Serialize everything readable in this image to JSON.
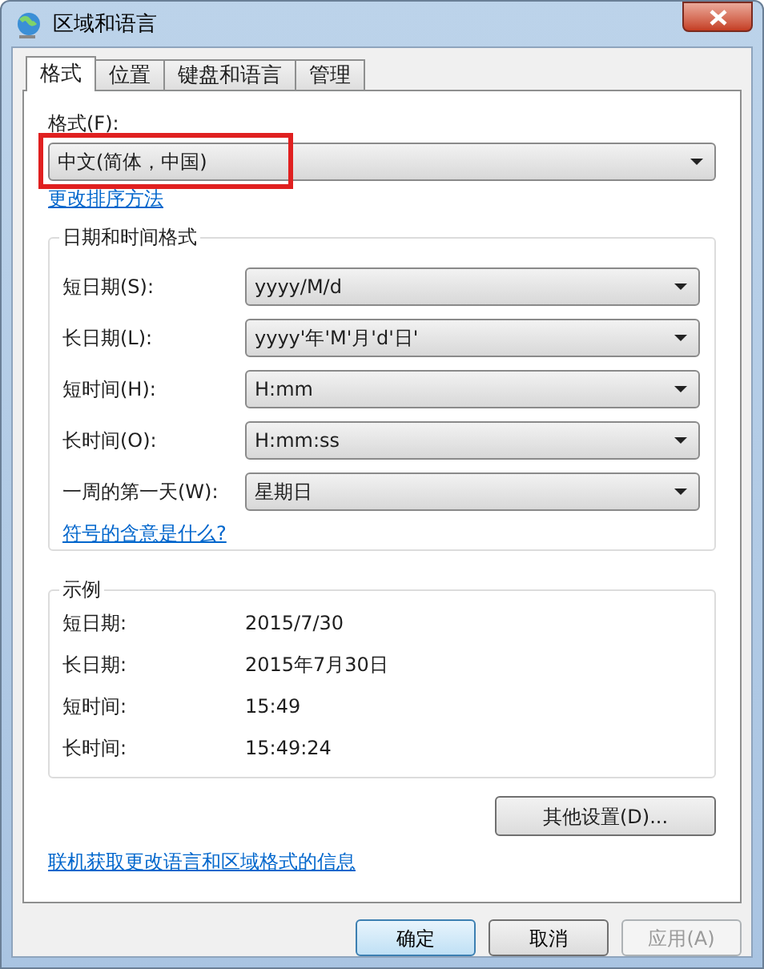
{
  "window": {
    "title": "区域和语言"
  },
  "tabs": [
    {
      "label": "格式",
      "selected": true
    },
    {
      "label": "位置",
      "selected": false
    },
    {
      "label": "键盘和语言",
      "selected": false
    },
    {
      "label": "管理",
      "selected": false
    }
  ],
  "format": {
    "label": "格式(F):",
    "value": "中文(简体，中国)",
    "highlighted": true
  },
  "sort_link": "更改排序方法",
  "datetime_group": {
    "title": "日期和时间格式",
    "fields": [
      {
        "label": "短日期(S):",
        "value": "yyyy/M/d"
      },
      {
        "label": "长日期(L):",
        "value": "yyyy'年'M'月'd'日'"
      },
      {
        "label": "短时间(H):",
        "value": "H:mm"
      },
      {
        "label": "长时间(O):",
        "value": "H:mm:ss"
      },
      {
        "label": "一周的第一天(W):",
        "value": "星期日"
      }
    ]
  },
  "symbols_link": "符号的含意是什么?",
  "example_group": {
    "title": "示例",
    "rows": [
      {
        "label": "短日期:",
        "value": "2015/7/30"
      },
      {
        "label": "长日期:",
        "value": "2015年7月30日"
      },
      {
        "label": "短时间:",
        "value": "15:49"
      },
      {
        "label": "长时间:",
        "value": "15:49:24"
      }
    ]
  },
  "other_settings_button": "其他设置(D)...",
  "online_link": "联机获取更改语言和区域格式的信息",
  "buttons": [
    {
      "label": "确定",
      "default": true,
      "disabled": false
    },
    {
      "label": "取消",
      "default": false,
      "disabled": false
    },
    {
      "label": "应用(A)",
      "default": false,
      "disabled": true
    }
  ]
}
